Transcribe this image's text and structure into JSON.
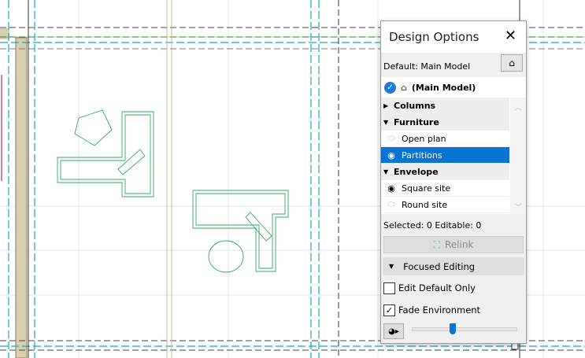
{
  "panel": {
    "title": "Design Options",
    "default_label": "Default: Main Model",
    "main_model": "(Main Model)",
    "groups": [
      {
        "label": "Columns",
        "expanded": false,
        "items": []
      },
      {
        "label": "Furniture",
        "expanded": true,
        "items": [
          {
            "label": "Open plan",
            "visible": false,
            "selected": false
          },
          {
            "label": "Partitions",
            "visible": true,
            "selected": true
          }
        ]
      },
      {
        "label": "Envelope",
        "expanded": true,
        "items": [
          {
            "label": "Square site",
            "visible": true,
            "selected": false
          },
          {
            "label": "Round site",
            "visible": false,
            "selected": false
          }
        ]
      }
    ],
    "status": "Selected: 0 Editable: 0",
    "relink_label": "Relink",
    "focused_editing_label": "Focused Editing",
    "edit_default_only": {
      "label": "Edit Default Only",
      "checked": false
    },
    "fade_environment": {
      "label": "Fade Environment",
      "checked": true
    },
    "fade_level": 0.39,
    "accent": "#0a74d4"
  }
}
